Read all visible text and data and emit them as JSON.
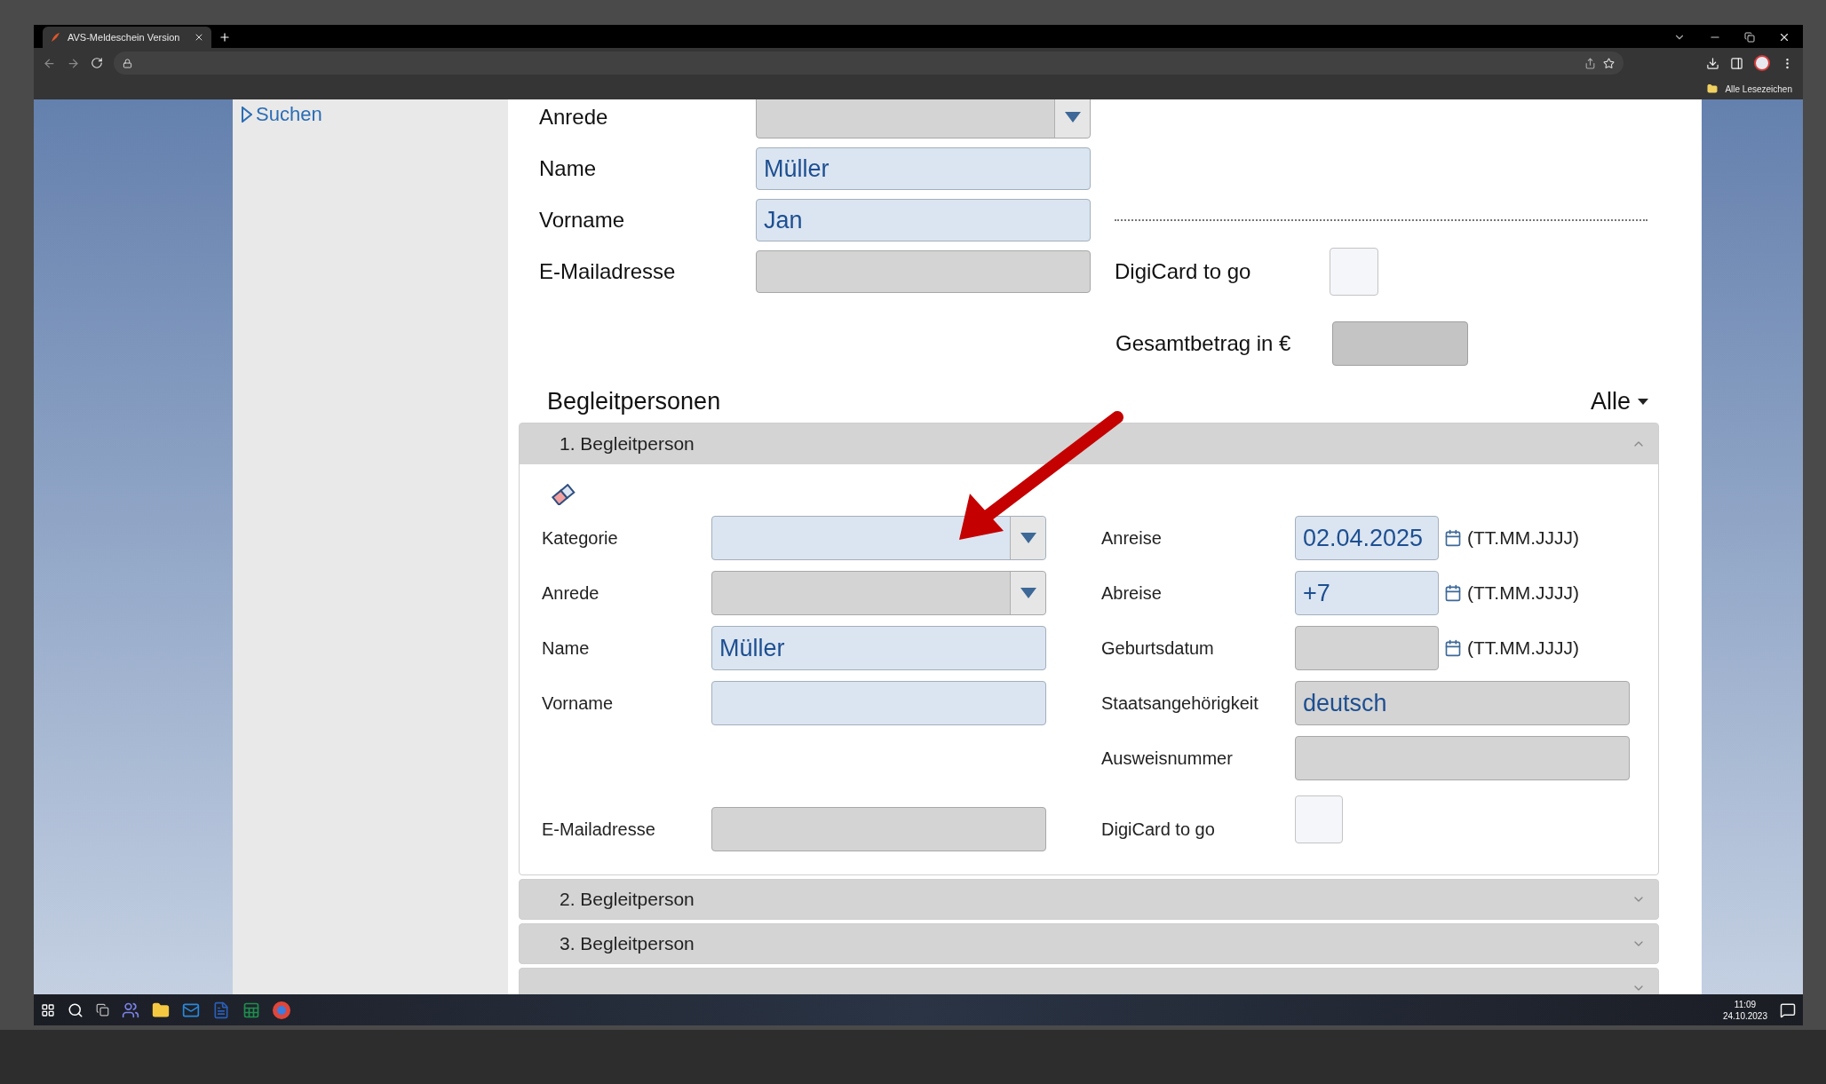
{
  "browser": {
    "tab_title": "AVS-Meldeschein Version",
    "bookmarks_label": "Alle Lesezeichen"
  },
  "sidebar": {
    "link": "Suchen"
  },
  "guest": {
    "rows": [
      {
        "label": "Anrede",
        "field": {
          "kind": "select",
          "highlighted": false
        }
      },
      {
        "label": "Name",
        "field": {
          "kind": "text",
          "highlighted": true,
          "value": "Müller"
        }
      },
      {
        "label": "Vorname",
        "field": {
          "kind": "text",
          "highlighted": true,
          "value": "Jan"
        },
        "separator": true
      },
      {
        "label": "E-Mailadresse",
        "field": {
          "kind": "text",
          "highlighted": false
        },
        "side": {
          "label": "DigiCard to go",
          "checked": false
        }
      }
    ],
    "total": {
      "label": "Gesamtbetrag in €"
    }
  },
  "companions": {
    "heading": "Begleitpersonen",
    "filter": "Alle",
    "panels": [
      {
        "title": "1. Begleitperson",
        "expanded": true,
        "rows": [
          {
            "left": {
              "label": "Kategorie",
              "field": {
                "kind": "select",
                "highlighted": true
              }
            },
            "right": {
              "label": "Anreise",
              "field": {
                "kind": "date",
                "highlighted": true,
                "value": "02.04.2025",
                "hint": "(TT.MM.JJJJ)"
              }
            }
          },
          {
            "left": {
              "label": "Anrede",
              "field": {
                "kind": "select",
                "highlighted": false
              }
            },
            "right": {
              "label": "Abreise",
              "field": {
                "kind": "date",
                "highlighted": true,
                "value": "+7",
                "hint": "(TT.MM.JJJJ)"
              }
            }
          },
          {
            "left": {
              "label": "Name",
              "field": {
                "kind": "text",
                "highlighted": true,
                "value": "Müller"
              }
            },
            "right": {
              "label": "Geburtsdatum",
              "field": {
                "kind": "date",
                "highlighted": false,
                "hint": "(TT.MM.JJJJ)"
              }
            }
          },
          {
            "left": {
              "label": "Vorname",
              "field": {
                "kind": "text",
                "highlighted": true
              }
            },
            "right": {
              "label": "Staatsangehörigkeit",
              "field": {
                "kind": "text",
                "highlighted": false,
                "value": "deutsch"
              }
            }
          },
          {
            "right": {
              "label": "Ausweisnummer",
              "field": {
                "kind": "text",
                "highlighted": false
              }
            }
          },
          {
            "left": {
              "label": "E-Mailadresse",
              "field": {
                "kind": "text",
                "highlighted": false
              }
            },
            "right": {
              "label": "DigiCard to go",
              "field": {
                "kind": "checkbox",
                "checked": false
              }
            }
          }
        ]
      },
      {
        "title": "2. Begleitperson",
        "expanded": false
      },
      {
        "title": "3. Begleitperson",
        "expanded": false
      },
      {
        "expanded": false
      }
    ]
  },
  "taskbar": {
    "time": "11:09",
    "date": "24.10.2023"
  }
}
